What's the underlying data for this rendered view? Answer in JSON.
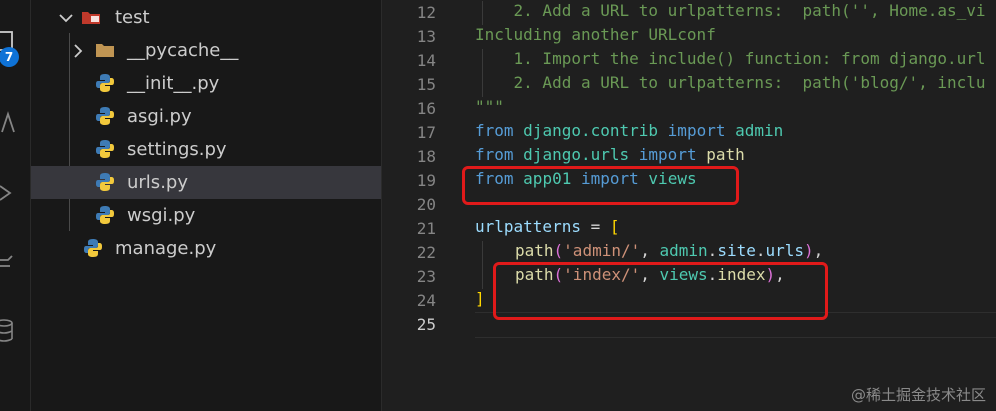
{
  "activity_bar": {
    "icons": [
      "explorer-icon",
      "search-icon",
      "source-control-icon",
      "run-debug-icon",
      "database-icon"
    ],
    "badge_count": "7"
  },
  "explorer": {
    "items": [
      {
        "label": "test",
        "icon": "folder-open-icon",
        "chevron": "chevron-down-icon"
      },
      {
        "label": "__pycache__",
        "icon": "folder-icon",
        "chevron": "chevron-right-icon"
      },
      {
        "label": "__init__.py",
        "icon": "python-icon"
      },
      {
        "label": "asgi.py",
        "icon": "python-icon"
      },
      {
        "label": "settings.py",
        "icon": "python-icon"
      },
      {
        "label": "urls.py",
        "icon": "python-icon",
        "selected": true
      },
      {
        "label": "wsgi.py",
        "icon": "python-icon"
      },
      {
        "label": "manage.py",
        "icon": "python-icon"
      }
    ]
  },
  "editor": {
    "line_numbers": [
      "12",
      "13",
      "14",
      "15",
      "16",
      "17",
      "18",
      "19",
      "20",
      "21",
      "22",
      "23",
      "24",
      "25"
    ],
    "active_line": "25",
    "code": {
      "l12": "    2. Add a URL to urlpatterns:  path('', Home.as_vi",
      "l13": "Including another URLconf",
      "l14": "    1. Import the include() function: from django.url",
      "l15": "    2. Add a URL to urlpatterns:  path('blog/', inclu",
      "l16": "\"\"\"",
      "from": "from",
      "import": "import",
      "l17_module": "django.contrib",
      "l17_name": "admin",
      "l18_module": "django.urls",
      "l18_name": "path",
      "l19_module": "app01",
      "l19_name": "views",
      "l21_var": "urlpatterns",
      "l21_eq": " = ",
      "l21_bracket": "[",
      "path_fn": "path",
      "paren_open": "(",
      "paren_close": ")",
      "l22_str": "'admin/'",
      "comma_space": ", ",
      "l22_obj": "admin",
      "dot": ".",
      "l22_site": "site",
      "l22_urls": "urls",
      "trailing_comma": ",",
      "l23_str": "'index/'",
      "l23_obj": "views",
      "l23_attr": "index",
      "l24_bracket": "]"
    }
  },
  "watermark": "@稀土掘金技术社区",
  "colors": {
    "highlight": "#e01a1a",
    "badge": "#0e72d6"
  }
}
